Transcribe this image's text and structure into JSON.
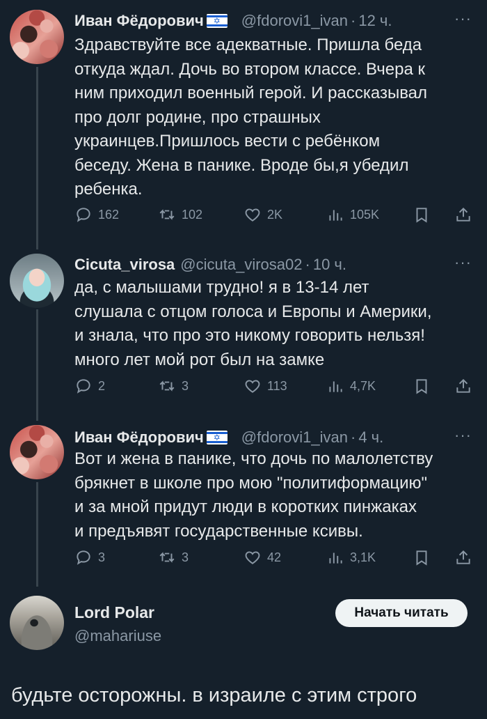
{
  "tweets": [
    {
      "name": "Иван Фёдорович",
      "flag": "israel-flag",
      "handle": "@fdorovi1_ivan",
      "time": "12 ч.",
      "more": "···",
      "lines": [
        "Здравствуйте все адекватные. Пришла беда",
        "откуда ждал. Дочь во втором классе. Вчера к",
        "ним приходил военный герой. И рассказывал",
        "про долг родине, про страшных",
        "украинцев.Пришлось вести с ребёнком",
        "беседу. Жена в панике. Вроде бы,я убедил",
        "ребенка."
      ],
      "replies": "162",
      "retweets": "102",
      "likes": "2K",
      "views": "105K"
    },
    {
      "name": "Cicuta_virosa",
      "handle": "@cicuta_virosa02",
      "time": "10 ч.",
      "more": "···",
      "lines": [
        "да, с малышами трудно! я в 13-14 лет",
        "слушала с отцом голоса и Европы и Америки,",
        "и знала, что про это никому говорить нельзя!",
        "много лет мой рот был на замке"
      ],
      "replies": "2",
      "retweets": "3",
      "likes": "113",
      "views": "4,7K"
    },
    {
      "name": "Иван Фёдорович",
      "flag": "israel-flag",
      "handle": "@fdorovi1_ivan",
      "time": "4 ч.",
      "more": "···",
      "lines": [
        "Вот и жена в панике, что дочь по малолетству",
        "брякнет в школе про мою \"политиформацию\"",
        "и за мной придут люди в коротких пинжаках",
        "и предъявят государственные ксивы."
      ],
      "replies": "3",
      "retweets": "3",
      "likes": "42",
      "views": "3,1K"
    }
  ],
  "author": {
    "name": "Lord Polar",
    "handle": "@mahariuse",
    "follow_label": "Начать читать"
  },
  "main_text": "будьте осторожны. в израиле с этим строго",
  "colors": {
    "background": "#15202b",
    "text": "#e7e9ea",
    "muted": "#8b98a5",
    "line": "#38444d",
    "button": "#eff3f4"
  },
  "icons": [
    "reply-icon",
    "retweet-icon",
    "like-icon",
    "views-icon",
    "bookmark-icon",
    "share-icon"
  ]
}
